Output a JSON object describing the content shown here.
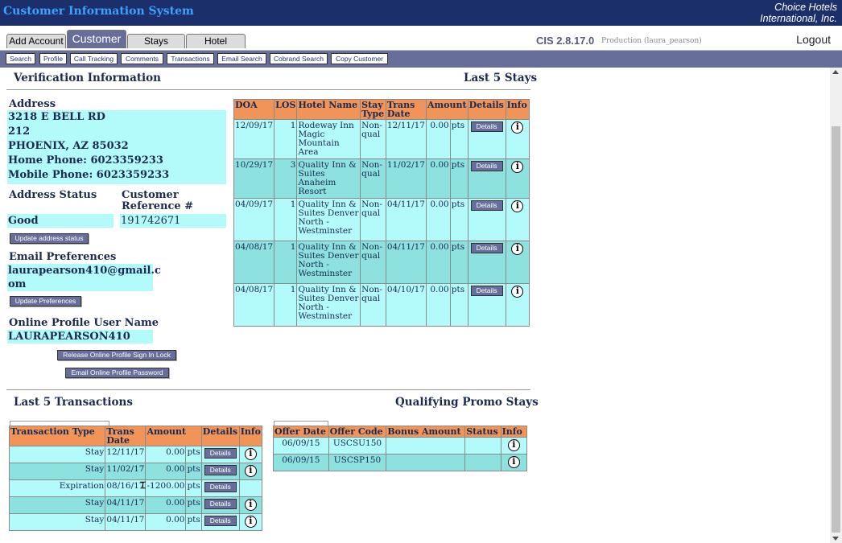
{
  "header": {
    "app_title": "Customer Information System",
    "company_line1": "Choice Hotels",
    "company_line2": "International, Inc."
  },
  "tabs": [
    {
      "label": "Add Account"
    },
    {
      "label": "Customer"
    },
    {
      "label": "Stays"
    },
    {
      "label": "Hotel"
    }
  ],
  "version": "CIS 2.8.17.0",
  "environment": "Production (laura_pearson)",
  "logout_label": "Logout",
  "subnav": [
    "Search",
    "Profile",
    "Call Tracking",
    "Comments",
    "Transactions",
    "Email Search",
    "Cobrand Search",
    "Copy Customer"
  ],
  "verification": {
    "title": "Verification Information",
    "address_label": "Address",
    "address_line1": "3218 E BELL RD",
    "address_line2": "212",
    "city_state_zip": "PHOENIX,  AZ  85032",
    "home_phone": "Home Phone:  6023359233",
    "mobile_phone": "Mobile Phone:  6023359233",
    "address_status_label": "Address Status",
    "address_status": "Good",
    "customer_ref_label1": "Customer",
    "customer_ref_label2": "Reference #",
    "customer_ref": "191742671",
    "update_address_btn": "Update address status",
    "email_pref_label": "Email Preferences",
    "email_line1": "laurapearson410@gmail.c",
    "email_line2": "om",
    "update_pref_btn": "Update Preferences",
    "online_user_label": "Online Profile User Name",
    "online_user": "LAURAPEARSON410",
    "release_lock_btn": "Release Online Profile Sign In Lock",
    "email_password_btn": "Email Online Profile Password"
  },
  "stays": {
    "title": "Last 5 Stays",
    "headers": [
      "DOA",
      "LOS",
      "Hotel Name",
      "Stay Type",
      "Trans Date",
      "Amount",
      "Details",
      "Info"
    ],
    "rows": [
      {
        "doa": "12/09/17",
        "los": "1",
        "hotel": "Rodeway Inn Magic Mountain Area",
        "type": "Non-qual",
        "trans": "12/11/17",
        "amount": "0.00",
        "unit": "pts"
      },
      {
        "doa": "10/29/17",
        "los": "3",
        "hotel": "Quality Inn & Suites Anaheim Resort",
        "type": "Non-qual",
        "trans": "11/02/17",
        "amount": "0.00",
        "unit": "pts"
      },
      {
        "doa": "04/09/17",
        "los": "1",
        "hotel": "Quality Inn & Suites Denver North - Westminster",
        "type": "Non-qual",
        "trans": "04/11/17",
        "amount": "0.00",
        "unit": "pts"
      },
      {
        "doa": "04/08/17",
        "los": "1",
        "hotel": "Quality Inn & Suites Denver North - Westminster",
        "type": "Non-qual",
        "trans": "04/11/17",
        "amount": "0.00",
        "unit": "pts"
      },
      {
        "doa": "04/08/17",
        "los": "1",
        "hotel": "Quality Inn & Suites Denver North - Westminster",
        "type": "Non-qual",
        "trans": "04/10/17",
        "amount": "0.00",
        "unit": "pts"
      }
    ]
  },
  "details_label": "Details",
  "info_glyph": "i",
  "transactions": {
    "title": "Last 5 Transactions",
    "headers": [
      "Transaction Type",
      "Trans Date",
      "Amount",
      "Details",
      "Info"
    ],
    "rows": [
      {
        "type": "Stay",
        "date": "12/11/17",
        "amount": "0.00",
        "unit": "pts",
        "info": true
      },
      {
        "type": "Stay",
        "date": "11/02/17",
        "amount": "0.00",
        "unit": "pts",
        "info": true
      },
      {
        "type": "Expiration",
        "date": "08/16/17",
        "amount": "-1200.00",
        "unit": "pts",
        "info": false
      },
      {
        "type": "Stay",
        "date": "04/11/17",
        "amount": "0.00",
        "unit": "pts",
        "info": true
      },
      {
        "type": "Stay",
        "date": "04/11/17",
        "amount": "0.00",
        "unit": "pts",
        "info": true
      }
    ]
  },
  "promo": {
    "title": "Qualifying Promo Stays",
    "headers": [
      "Offer Date",
      "Offer Code",
      "Bonus Amount",
      "Status",
      "Info"
    ],
    "rows": [
      {
        "date": "06/09/15",
        "code": "USCSU150",
        "bonus": "",
        "status": ""
      },
      {
        "date": "06/09/15",
        "code": "USCSP150",
        "bonus": "",
        "status": ""
      }
    ]
  },
  "colors": {
    "header_bg": "#1b2f6b",
    "accent": "#676e9a",
    "table_header": "#f0945a",
    "row_light": "#b3fafa",
    "row_dark": "#8de1df"
  }
}
